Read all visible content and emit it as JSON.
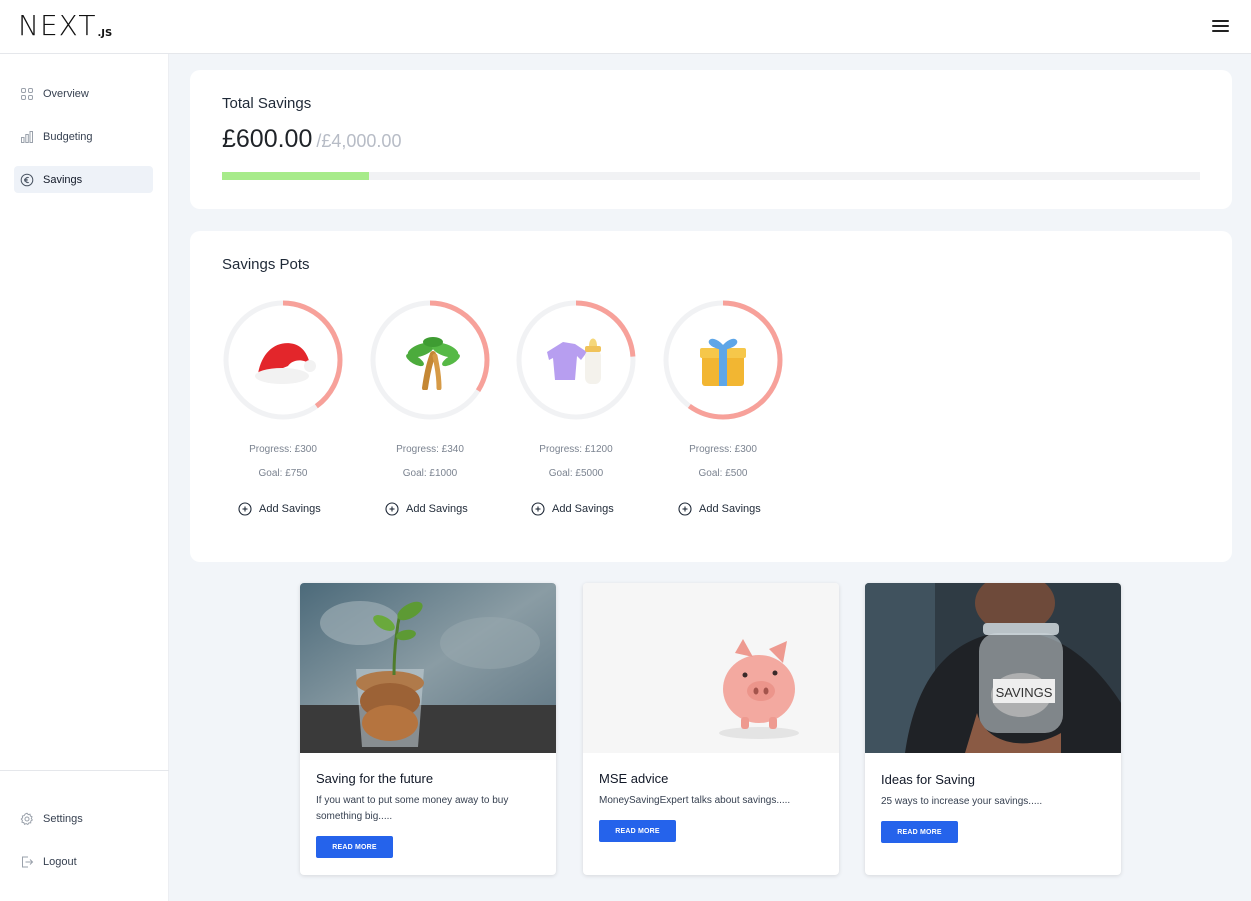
{
  "header": {
    "logo_main": "NEXT",
    "logo_sub": ".JS",
    "menu_icon": "hamburger-menu-icon"
  },
  "sidebar": {
    "items": [
      {
        "label": "Overview",
        "icon": "grid-icon",
        "active": false
      },
      {
        "label": "Budgeting",
        "icon": "bar-chart-icon",
        "active": false
      },
      {
        "label": "Savings",
        "icon": "euro-circle-icon",
        "active": true
      }
    ],
    "bottom_items": [
      {
        "label": "Settings",
        "icon": "gear-icon"
      },
      {
        "label": "Logout",
        "icon": "logout-icon"
      }
    ]
  },
  "total_savings": {
    "title": "Total Savings",
    "amount": "£600.00",
    "goal": "/£4,000.00",
    "progress_fraction": 0.15,
    "fill_color": "#a7eb8a"
  },
  "savings_pots": {
    "title": "Savings Pots",
    "ring_color": "#f7a19a",
    "track_color": "#f1f2f4",
    "add_label": "Add Savings",
    "pots": [
      {
        "emoji": "🎅",
        "icon": "santa-hat-icon",
        "progress": "Progress: £300",
        "goal": "Goal: £750",
        "fraction": 0.4
      },
      {
        "emoji": "🌴",
        "icon": "palm-tree-icon",
        "progress": "Progress: £340",
        "goal": "Goal: £1000",
        "fraction": 0.34
      },
      {
        "emoji": "🍼",
        "icon": "baby-items-icon",
        "progress": "Progress: £1200",
        "goal": "Goal: £5000",
        "fraction": 0.24
      },
      {
        "emoji": "🎁",
        "icon": "gift-icon",
        "progress": "Progress: £300",
        "goal": "Goal: £500",
        "fraction": 0.6
      }
    ]
  },
  "articles": [
    {
      "title": "Saving for the future",
      "desc": "If you want to put some money away to buy something big.....",
      "button": "READ MORE",
      "image": "coins-plant-jar-image"
    },
    {
      "title": "MSE advice",
      "desc": "MoneySavingExpert talks about savings.....",
      "button": "READ MORE",
      "image": "piggy-bank-image"
    },
    {
      "title": "Ideas for Saving",
      "desc": "25 ways to increase your savings.....",
      "button": "READ MORE",
      "image": "savings-jar-hand-image"
    }
  ]
}
